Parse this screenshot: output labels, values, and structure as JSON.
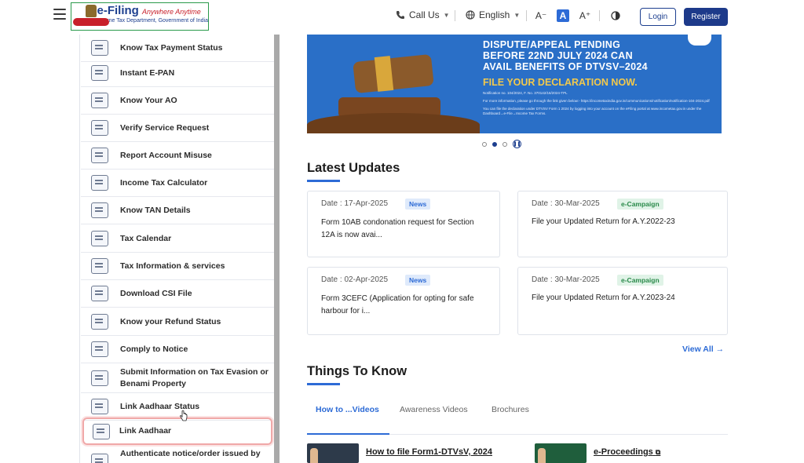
{
  "header": {
    "logo_title": "e-Filing",
    "logo_tagline": "Anywhere Anytime",
    "logo_subtitle": "Income Tax Department, Government of India",
    "call_us": "Call Us",
    "language": "English",
    "font_decrease": "A⁻",
    "font_normal": "A",
    "font_increase": "A⁺",
    "contrast_icon": "contrast-icon",
    "login": "Login",
    "register": "Register"
  },
  "sidebar": {
    "items": [
      {
        "label": "Know Tax Payment Status",
        "icon": "payment-status-icon"
      },
      {
        "label": "Instant E-PAN",
        "icon": "epan-card-icon"
      },
      {
        "label": "Know Your AO",
        "icon": "ao-user-icon"
      },
      {
        "label": "Verify Service Request",
        "icon": "verify-request-icon"
      },
      {
        "label": "Report Account Misuse",
        "icon": "report-misuse-icon"
      },
      {
        "label": "Income Tax Calculator",
        "icon": "calculator-icon"
      },
      {
        "label": "Know TAN Details",
        "icon": "tan-details-icon"
      },
      {
        "label": "Tax Calendar",
        "icon": "calendar-icon"
      },
      {
        "label": "Tax Information & services",
        "icon": "info-icon"
      },
      {
        "label": "Download CSI File",
        "icon": "csi-file-icon"
      },
      {
        "label": "Know your Refund Status",
        "icon": "refund-icon"
      },
      {
        "label": "Comply to Notice",
        "icon": "notice-icon"
      },
      {
        "label": "Submit Information on Tax Evasion or Benami Property",
        "icon": "tax-evasion-icon"
      },
      {
        "label": "Link Aadhaar Status",
        "icon": "aadhaar-status-icon"
      },
      {
        "label": "Link Aadhaar",
        "icon": "aadhaar-link-icon"
      },
      {
        "label": "Authenticate notice/order issued by",
        "icon": "authenticate-notice-icon"
      }
    ]
  },
  "banner": {
    "lines": [
      "DISPUTE/APPEAL PENDING",
      "BEFORE 22ND JULY 2024 CAN",
      "AVAIL  BENEFITS OF DTVSV–2024"
    ],
    "cta": "FILE YOUR DECLARATION NOW.",
    "notification": "Notification no. 104/2024, F. No. 370142/16/2024-TPL",
    "more_info": "For more information, please go through the link given below:- https://incometaxindia.gov.in/communications/notification/notification-104-2024.pdf",
    "instructions": "You can file the declaration under DTVSV Form 1 2024 by logging into your account on the eFiling portal at www.incometax.gov.in under the Dashboard→e-File→Income Tax Forms."
  },
  "latest_updates": {
    "title": "Latest Updates",
    "cards": [
      {
        "date": "Date : 17-Apr-2025",
        "badge": "News",
        "text": "Form 10AB condonation request for Section 12A is now avai..."
      },
      {
        "date": "Date : 30-Mar-2025",
        "badge": "e-Campaign",
        "text": "File your Updated Return for A.Y.2022-23"
      },
      {
        "date": "Date : 02-Apr-2025",
        "badge": "News",
        "text": "Form 3CEFC (Application for opting for safe harbour for i..."
      },
      {
        "date": "Date : 30-Mar-2025",
        "badge": "e-Campaign",
        "text": "File your Updated Return for A.Y.2023-24"
      }
    ],
    "view_all": "View All"
  },
  "things_to_know": {
    "title": "Things To Know",
    "tabs": [
      "How to ...Videos",
      "Awareness Videos",
      "Brochures"
    ],
    "videos": [
      "How to file Form1-DTVsV, 2024",
      "e-Proceedings"
    ]
  },
  "colors": {
    "primary": "#1d3f8f",
    "accent": "#2d6bd6",
    "banner_bg": "#2a6fc7",
    "highlight": "#f0a8a8"
  }
}
